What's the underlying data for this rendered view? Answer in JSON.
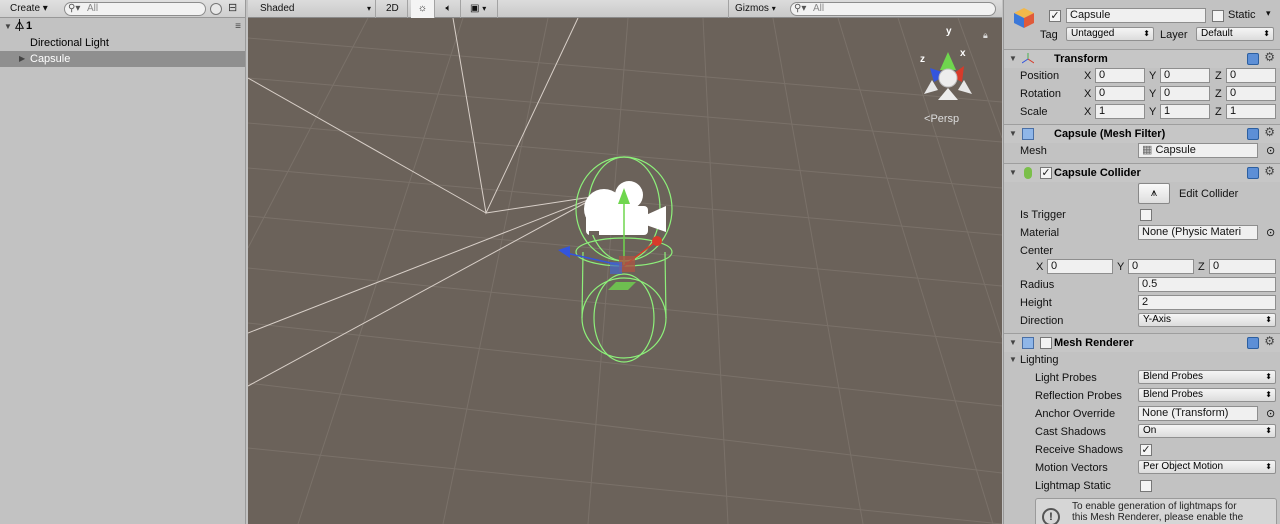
{
  "hierarchy": {
    "create_label": "Create",
    "search_placeholder": "All",
    "scene_name": "1",
    "items": [
      {
        "label": "Directional Light",
        "selected": false
      },
      {
        "label": "Capsule",
        "selected": true
      }
    ]
  },
  "scene_view": {
    "shading_mode": "Shaded",
    "mode_2d": "2D",
    "gizmos_label": "Gizmos",
    "search_placeholder": "All",
    "projection_label": "Persp",
    "gizmo_axes": {
      "y": "y",
      "z": "z",
      "x": "x"
    }
  },
  "inspector": {
    "object_name": "Capsule",
    "active": true,
    "static_label": "Static",
    "tag_label": "Tag",
    "tag_value": "Untagged",
    "layer_label": "Layer",
    "layer_value": "Default",
    "transform": {
      "title": "Transform",
      "position_label": "Position",
      "rotation_label": "Rotation",
      "scale_label": "Scale",
      "position": {
        "x": "0",
        "y": "0",
        "z": "0"
      },
      "rotation": {
        "x": "0",
        "y": "0",
        "z": "0"
      },
      "scale": {
        "x": "1",
        "y": "1",
        "z": "1"
      }
    },
    "mesh_filter": {
      "title": "Capsule (Mesh Filter)",
      "mesh_label": "Mesh",
      "mesh_value": "Capsule"
    },
    "capsule_collider": {
      "title": "Capsule Collider",
      "edit_label": "Edit Collider",
      "is_trigger_label": "Is Trigger",
      "material_label": "Material",
      "material_value": "None (Physic Materi",
      "center_label": "Center",
      "center": {
        "x": "0",
        "y": "0",
        "z": "0"
      },
      "radius_label": "Radius",
      "radius_value": "0.5",
      "height_label": "Height",
      "height_value": "2",
      "direction_label": "Direction",
      "direction_value": "Y-Axis"
    },
    "mesh_renderer": {
      "title": "Mesh Renderer",
      "lighting_label": "Lighting",
      "light_probes_label": "Light Probes",
      "light_probes_value": "Blend Probes",
      "reflection_probes_label": "Reflection Probes",
      "reflection_probes_value": "Blend Probes",
      "anchor_override_label": "Anchor Override",
      "anchor_override_value": "None (Transform)",
      "cast_shadows_label": "Cast Shadows",
      "cast_shadows_value": "On",
      "receive_shadows_label": "Receive Shadows",
      "motion_vectors_label": "Motion Vectors",
      "motion_vectors_value": "Per Object Motion",
      "lightmap_static_label": "Lightmap Static",
      "info_line1": "To enable generation of lightmaps for",
      "info_line2": "this Mesh Renderer, please enable the"
    },
    "axis_labels": {
      "x": "X",
      "y": "Y",
      "z": "Z"
    }
  },
  "colors": {
    "scene_bg": "#6b625a",
    "collider_green": "#8df07a",
    "selection": "#8f8f8f",
    "panel": "#c2c2c2"
  }
}
